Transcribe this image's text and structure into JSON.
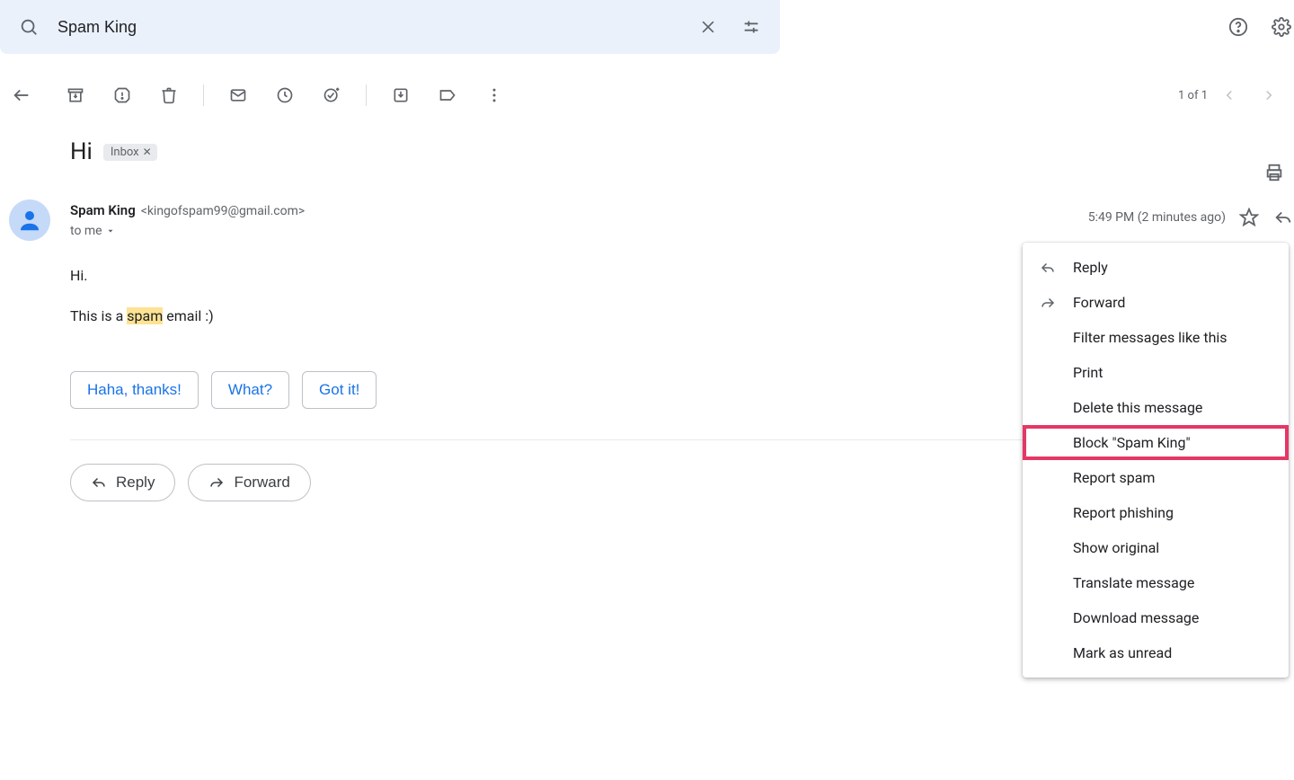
{
  "search": {
    "query": "Spam King"
  },
  "pager": {
    "label": "1 of 1"
  },
  "message": {
    "subject": "Hi",
    "label": "Inbox",
    "sender_name": "Spam King",
    "sender_email": "<kingofspam99@gmail.com>",
    "to_line": "to me",
    "timestamp": "5:49 PM (2 minutes ago)",
    "body_prefix": "Hi.",
    "body_line2_pre": "This is a ",
    "body_line2_highlight": "spam",
    "body_line2_post": " email :)"
  },
  "smart_replies": [
    "Haha, thanks!",
    "What?",
    "Got it!"
  ],
  "actions": {
    "reply": "Reply",
    "forward": "Forward"
  },
  "menu": {
    "reply": "Reply",
    "forward": "Forward",
    "filter": "Filter messages like this",
    "print": "Print",
    "delete": "Delete this message",
    "block": "Block \"Spam King\"",
    "report_spam": "Report spam",
    "report_phishing": "Report phishing",
    "show_original": "Show original",
    "translate": "Translate message",
    "download": "Download message",
    "mark_unread": "Mark as unread"
  }
}
